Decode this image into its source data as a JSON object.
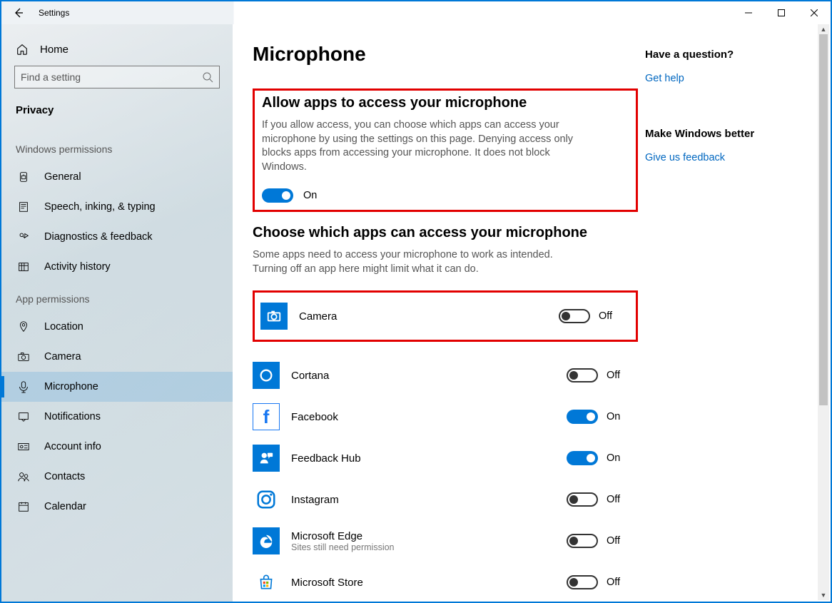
{
  "window": {
    "title": "Settings"
  },
  "sidebar": {
    "home": "Home",
    "search_placeholder": "Find a setting",
    "section": "Privacy",
    "group1": "Windows permissions",
    "group2": "App permissions",
    "win_items": [
      {
        "id": "general",
        "label": "General"
      },
      {
        "id": "speech",
        "label": "Speech, inking, & typing"
      },
      {
        "id": "diagnostics",
        "label": "Diagnostics & feedback"
      },
      {
        "id": "activity",
        "label": "Activity history"
      }
    ],
    "app_items": [
      {
        "id": "location",
        "label": "Location"
      },
      {
        "id": "camera",
        "label": "Camera"
      },
      {
        "id": "microphone",
        "label": "Microphone",
        "selected": true
      },
      {
        "id": "notifications",
        "label": "Notifications"
      },
      {
        "id": "account",
        "label": "Account info"
      },
      {
        "id": "contacts",
        "label": "Contacts"
      },
      {
        "id": "calendar",
        "label": "Calendar"
      }
    ]
  },
  "page": {
    "title": "Microphone",
    "allow_heading": "Allow apps to access your microphone",
    "allow_desc": "If you allow access, you can choose which apps can access your microphone by using the settings on this page. Denying access only blocks apps from accessing your microphone. It does not block Windows.",
    "master_state": "On",
    "choose_heading": "Choose which apps can access your microphone",
    "choose_desc": "Some apps need to access your microphone to work as intended. Turning off an app here might limit what it can do.",
    "apps": [
      {
        "name": "Camera",
        "state": "Off",
        "on": false,
        "icon": "camera"
      },
      {
        "name": "Cortana",
        "state": "Off",
        "on": false,
        "icon": "cortana"
      },
      {
        "name": "Facebook",
        "state": "On",
        "on": true,
        "icon": "facebook"
      },
      {
        "name": "Feedback Hub",
        "state": "On",
        "on": true,
        "icon": "feedback"
      },
      {
        "name": "Instagram",
        "state": "Off",
        "on": false,
        "icon": "instagram"
      },
      {
        "name": "Microsoft Edge",
        "sub": "Sites still need permission",
        "state": "Off",
        "on": false,
        "icon": "edge"
      },
      {
        "name": "Microsoft Store",
        "state": "Off",
        "on": false,
        "icon": "store"
      }
    ]
  },
  "aside": {
    "q_heading": "Have a question?",
    "q_link": "Get help",
    "fb_heading": "Make Windows better",
    "fb_link": "Give us feedback"
  }
}
